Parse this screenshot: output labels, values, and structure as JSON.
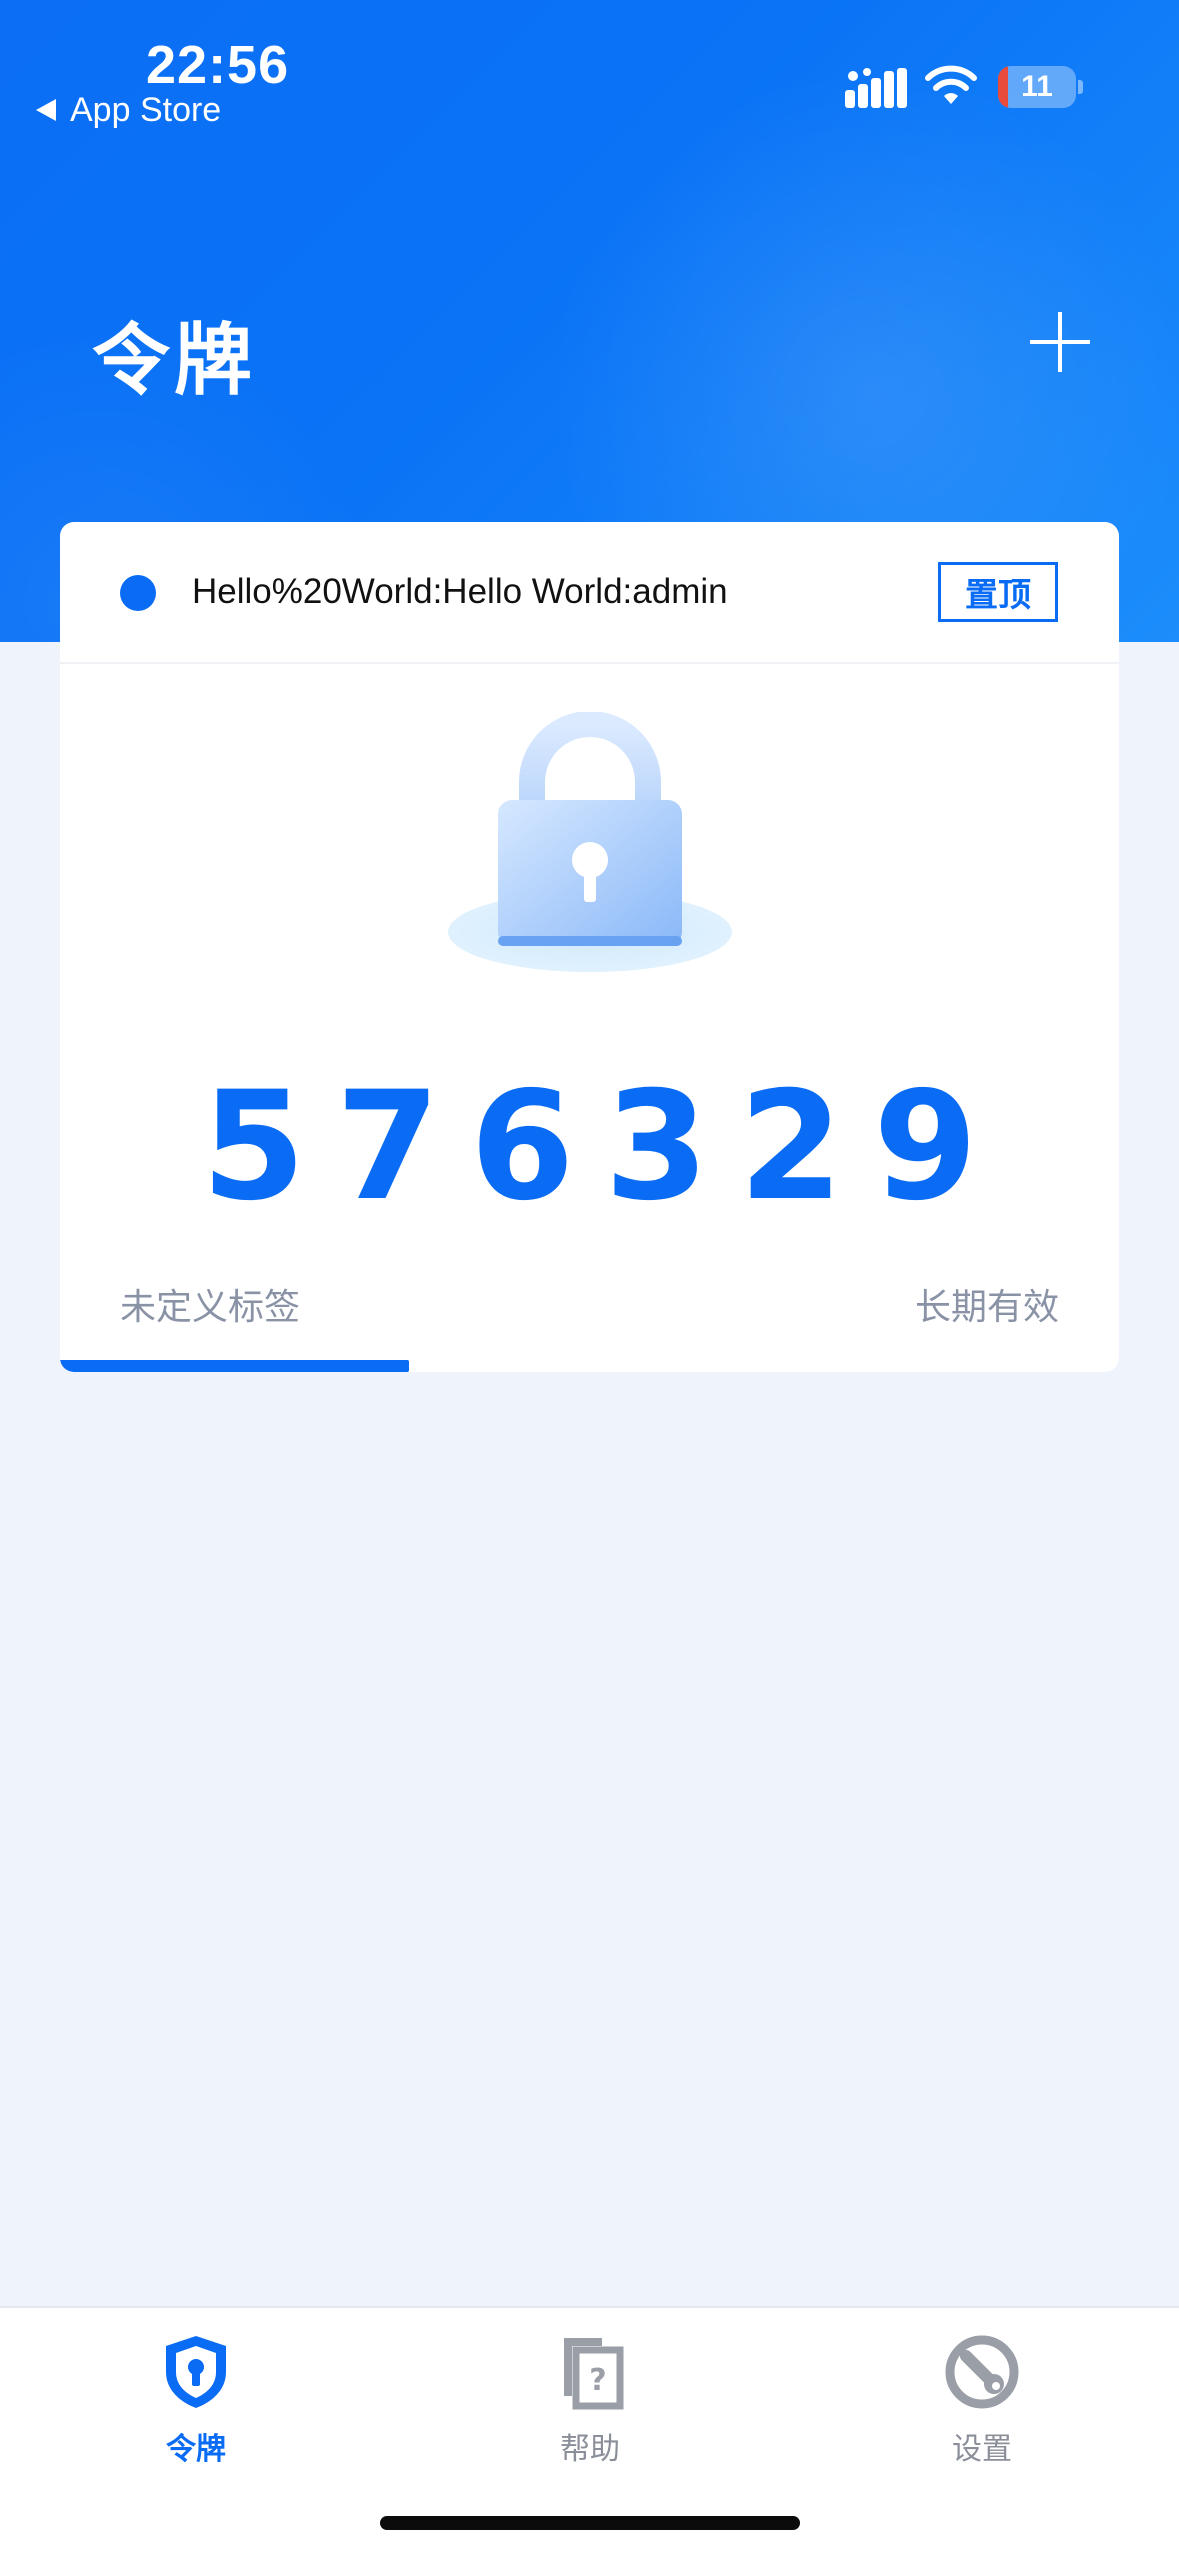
{
  "status_bar": {
    "time": "22:56",
    "back_label": "App Store",
    "battery": "11"
  },
  "header": {
    "title": "令牌",
    "add_icon": "plus-icon"
  },
  "token_card": {
    "account": "Hello%20World:Hello World:admin",
    "pin_label": "置顶",
    "code": "576329",
    "tag": "未定义标签",
    "validity": "长期有效",
    "progress_fraction": 0.33,
    "accent_color": "#0a6cf4"
  },
  "tabbar": {
    "tabs": [
      {
        "label": "令牌",
        "icon": "shield-key-icon",
        "active": true
      },
      {
        "label": "帮助",
        "icon": "help-document-icon",
        "active": false
      },
      {
        "label": "设置",
        "icon": "settings-wrench-icon",
        "active": false
      }
    ]
  },
  "colors": {
    "primary": "#0a6cf4",
    "background": "#eff3fb",
    "muted_text": "#8a93a6"
  }
}
